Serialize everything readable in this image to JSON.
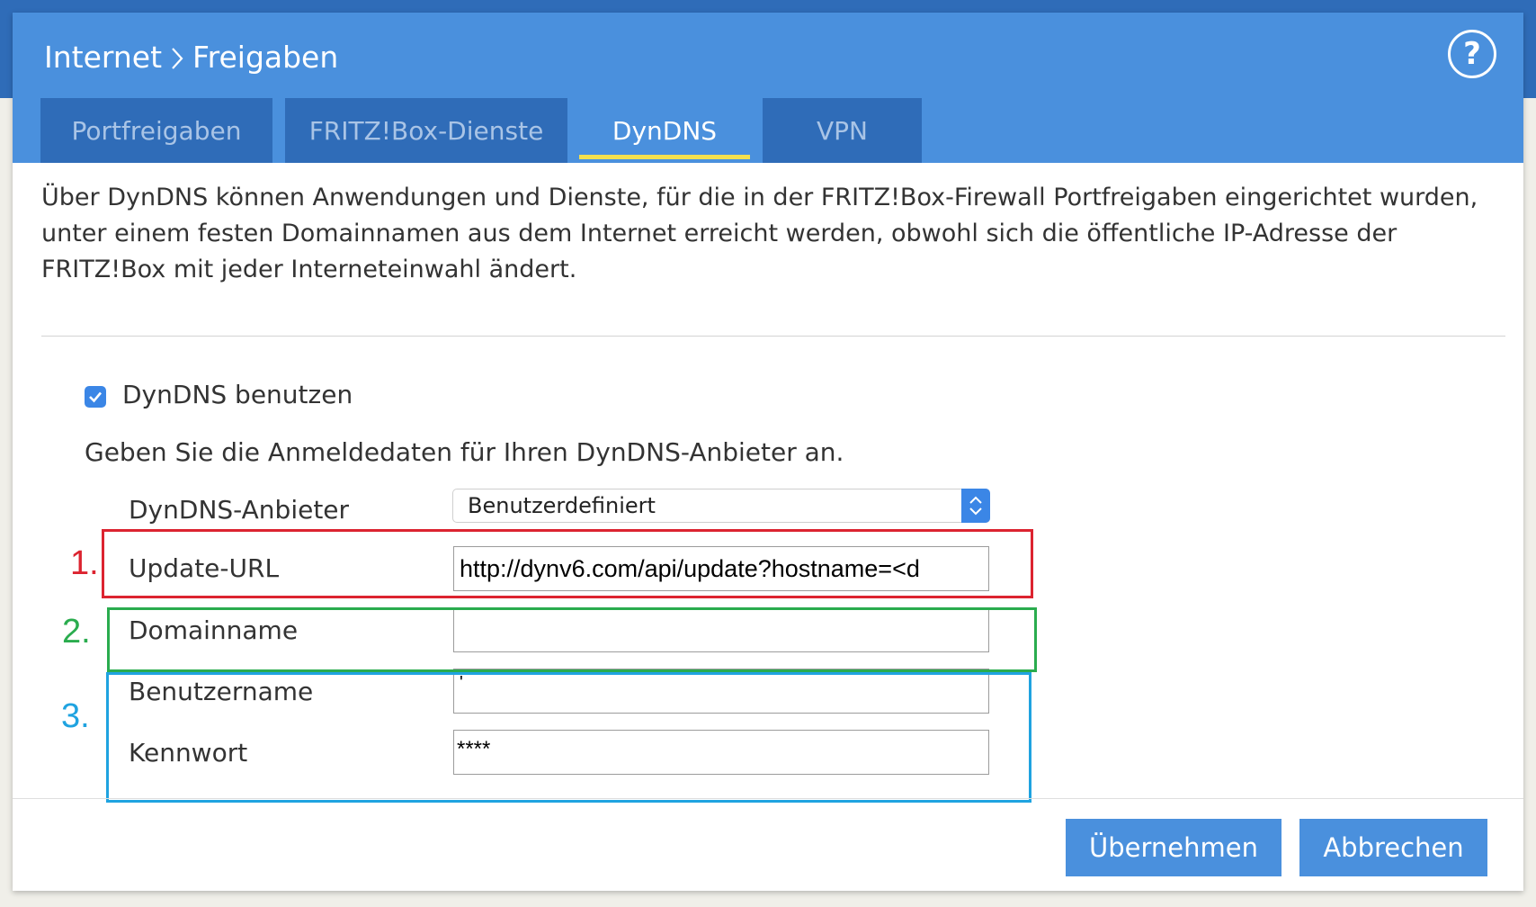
{
  "header": {
    "breadcrumb": [
      "Internet",
      "Freigaben"
    ],
    "help_symbol": "?",
    "help_icon": "question-circle-icon",
    "separator_icon": "chevron-right-icon"
  },
  "tabs": [
    {
      "label": "Portfreigaben",
      "active": false
    },
    {
      "label": "FRITZ!Box-Dienste",
      "active": false
    },
    {
      "label": "DynDNS",
      "active": true
    },
    {
      "label": "VPN",
      "active": false
    }
  ],
  "intro_text": "Über DynDNS können Anwendungen und Dienste, für die in der FRITZ!Box-Firewall Portfreigaben eingerichtet wurden, unter einem festen Domainnamen aus dem Internet erreicht werden, obwohl sich die öffentliche IP-Adresse der FRITZ!Box mit jeder Interneteinwahl ändert.",
  "use_dyndns": {
    "label": "DynDNS benutzen",
    "checked": true
  },
  "hint": "Geben Sie die Anmeldedaten für Ihren DynDNS-Anbieter an.",
  "form": {
    "provider": {
      "label": "DynDNS-Anbieter",
      "value": "Benutzerdefiniert"
    },
    "update_url": {
      "label": "Update-URL",
      "value": "http://dynv6.com/api/update?hostname=<d"
    },
    "domain": {
      "label": "Domainname",
      "value": ""
    },
    "username": {
      "label": "Benutzername",
      "value": "'"
    },
    "password": {
      "label": "Kennwort",
      "value": "****"
    }
  },
  "annotations": [
    {
      "label": "1.",
      "color": "#dc2430"
    },
    {
      "label": "2.",
      "color": "#2aac4e"
    },
    {
      "label": "3.",
      "color": "#1fa3e0"
    }
  ],
  "buttons": {
    "apply": "Übernehmen",
    "cancel": "Abbrechen"
  },
  "colors": {
    "header_blue": "#4a90dd",
    "tab_dark": "#2f6cb8",
    "active_underline": "#f4e04d",
    "accent": "#3b86e6"
  }
}
